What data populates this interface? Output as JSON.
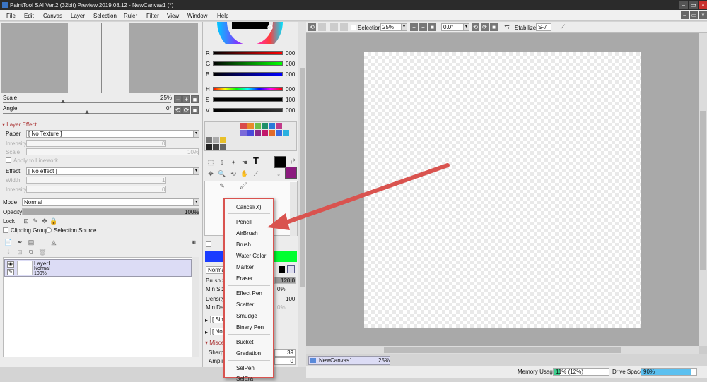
{
  "title": "PaintTool SAI Ver.2 (32bit) Preview.2019.08.12 - NewCanvas1 (*)",
  "menu": [
    "File",
    "Edit",
    "Canvas",
    "Layer",
    "Selection",
    "Ruler",
    "Filter",
    "View",
    "Window",
    "Help"
  ],
  "nav": {
    "scale_label": "Scale",
    "scale_value": "25%",
    "angle_label": "Angle",
    "angle_value": "0°"
  },
  "layer_effect": {
    "header": "Layer Effect",
    "paper_label": "Paper",
    "paper_value": "[ No Texture ]",
    "intensity_label": "Intensity",
    "intensity_value": "0",
    "scale_label": "Scale",
    "scale_value": "10%",
    "apply_linework": "Apply to Linework",
    "effect_label": "Effect",
    "effect_value": "[ No effect ]",
    "width_label": "Width",
    "width_value": "1",
    "intensity2_label": "Intensity",
    "intensity2_value": "0"
  },
  "layer_props": {
    "mode_label": "Mode",
    "mode_value": "Normal",
    "opacity_label": "Opacity",
    "opacity_value": "100%",
    "opacity_fraction": 1.0,
    "lock_label": "Lock",
    "clipping_group": "Clipping Group",
    "selection_source": "Selection Source"
  },
  "layers": [
    {
      "name": "Layer1",
      "mode": "Normal",
      "opacity": "100%"
    }
  ],
  "color": {
    "rows": [
      {
        "label": "R",
        "value": "000"
      },
      {
        "label": "G",
        "value": "000"
      },
      {
        "label": "B",
        "value": "000"
      },
      {
        "label": "H",
        "value": "000"
      },
      {
        "label": "S",
        "value": "100"
      },
      {
        "label": "V",
        "value": "000"
      }
    ],
    "primary": "#000000",
    "secondary": "#8b1a7e"
  },
  "brush": {
    "blend_value": "Norma",
    "size_label": "Brush S",
    "size_value": "120.0",
    "min_size_label": "Min Siz",
    "min_size_value": "0%",
    "density_label": "Density",
    "density_value": "100",
    "min_density_label": "Min De",
    "min_density_value": "0%",
    "shape_value": "[ Sim",
    "texture_value": "[ No",
    "misc_header": "Misce",
    "sharp_label": "Sharp",
    "sharp_value": "39",
    "amp_label": "Ampli",
    "amp_value": "0"
  },
  "popup": {
    "cancel": "Cancel(X)",
    "items": [
      "Pencil",
      "AirBrush",
      "Brush",
      "Water Color",
      "Marker",
      "Eraser",
      "Effect Pen",
      "Scatter",
      "Smudge",
      "Binary Pen",
      "Bucket",
      "Gradation",
      "SelPen",
      "SelEra"
    ]
  },
  "canvas_toolbar": {
    "selection_label": "Selection",
    "zoom_value": "25%",
    "rotation_value": "0.0°",
    "stabilizer_label": "Stabilizer",
    "stabilizer_value": "S-7"
  },
  "tab": {
    "name": "NewCanvas1",
    "zoom": "25%"
  },
  "status": {
    "memory_label": "Memory Usage",
    "memory_value": "11% (12%)",
    "memory_fraction": 0.11,
    "drive_label": "Drive Space",
    "drive_value": "90%",
    "drive_fraction": 0.9
  },
  "colors": {
    "accent_red": "#d9534f",
    "drive_fill": "#5bc0f0",
    "memory_fill": "#3ccf8e"
  }
}
